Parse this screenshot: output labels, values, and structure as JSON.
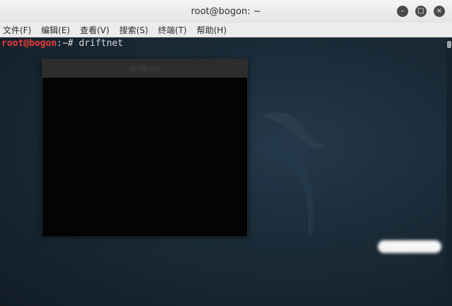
{
  "window": {
    "title": "root@bogon: ~",
    "buttons": {
      "minimize": "–",
      "maximize": "□",
      "close": "×"
    }
  },
  "menu": [
    {
      "label": "文件(F)"
    },
    {
      "label": "编辑(E)"
    },
    {
      "label": "查看(V)"
    },
    {
      "label": "搜索(S)"
    },
    {
      "label": "终端(T)"
    },
    {
      "label": "帮助(H)"
    }
  ],
  "terminal": {
    "user_host": "root@bogon",
    "prompt_rest": ":~# ",
    "command": "driftnet"
  },
  "driftnet_window": {
    "title": "driftnet"
  },
  "colors": {
    "prompt_user": "#e83c3c",
    "terminal_bg": "#1a2b38"
  }
}
